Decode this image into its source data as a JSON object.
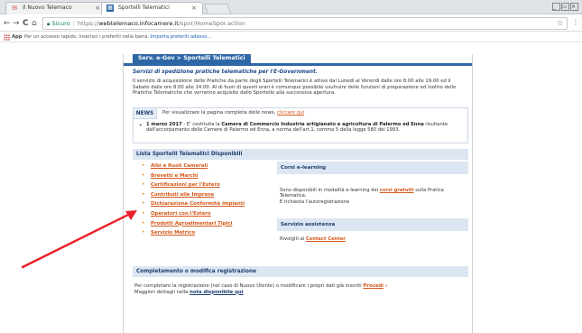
{
  "browser": {
    "tabs": [
      {
        "label": "Il Nuovo Telemaco",
        "close": "×"
      },
      {
        "label": "Sportelli Telematici",
        "close": "×"
      }
    ],
    "nav": {
      "back": "←",
      "forward": "→",
      "reload": "C",
      "home": "⌂"
    },
    "address": {
      "secure_label": "Sicuro",
      "divider": "|",
      "scheme": "https://",
      "host": "webtelemaco.infocamere.it",
      "path": "/spor/HomeSpor.action"
    },
    "bookmark_bar": {
      "apps_label": "App",
      "hint_text": "Per un accesso rapido, inserisci i preferiti nella barra.",
      "import_link": "Importa preferiti adesso..."
    },
    "window_controls": [
      "_",
      "▭",
      "×"
    ]
  },
  "page": {
    "tab_title": "Serv. e-Gov > Sportelli Telematici",
    "section_title": "Servizi di spedizione pratiche telematiche per l'E-Government.",
    "intro": "Il servizio di acquisizione delle Pratiche da parte degli Sportelli Telematici è attivo dal Lunedì al Venerdì dalle ore 8.00 alle 19.00 ed il Sabato dalle ore 8.00 alle 14.00. Al di fuori di questi orari è comunque possibile usufruire delle funzioni di preparazione ed inoltro delle Pratiche Telematiche che verranno acquisite dallo Sportello alla successiva apertura.",
    "news": {
      "label": "NEWS",
      "text": "Per visualizzare la pagina completa delle news,",
      "link": "cliccare qui",
      "bullet": "•",
      "item_date": "1 marzo 2017",
      "item_mid": " - E' costituita la ",
      "item_bold": "Camera di Commercio Industria artigianato e agricoltura di Palermo ed Enna",
      "item_rest": " risultante dall'accorpamento delle Camere di Palermo ed Enna, a norma dell'art.1, comma 5 della legge 580 del 1993."
    },
    "services_header": "Lista Sportelli Telematici Disponibili",
    "bullet": "•",
    "services": [
      "Albi e Ruoli Camerali",
      "Brevetti e Marchi",
      "Certificazioni per l'Estero",
      "Contributi alle Imprese",
      "Dichiarazione Conformità Impianti",
      "Operatori con l'Estero",
      "Prodotti Agroalimentari Tipici",
      "Servizio Metrico"
    ],
    "corsi": {
      "header": "Corsi e-learning",
      "text_before": "Sono disponibili in modalità e-learning dei ",
      "link": "corsi gratuiti",
      "text_after": " sulla Pratica Telematica.",
      "note": "E richiesta l'autoregistrazione"
    },
    "assistenza": {
      "header": "Servizio assistenza",
      "text": "Rivolgiti al ",
      "link": "Contact Center"
    },
    "completamento": {
      "header": "Completamento o modifica registrazione",
      "text": "Per completare la registrazione (nel caso di Nuovo Utente) o modificare i propri dati già inseriti",
      "procedi": "Procedi",
      "procedi_arrow": "»",
      "line2": "Maggiori dettagli nella ",
      "line2_link": "nota disponibile qui"
    }
  },
  "colors": {
    "brand_blue": "#2e67a5",
    "link_orange": "#d3591a",
    "annotation_red": "#e8202a"
  }
}
